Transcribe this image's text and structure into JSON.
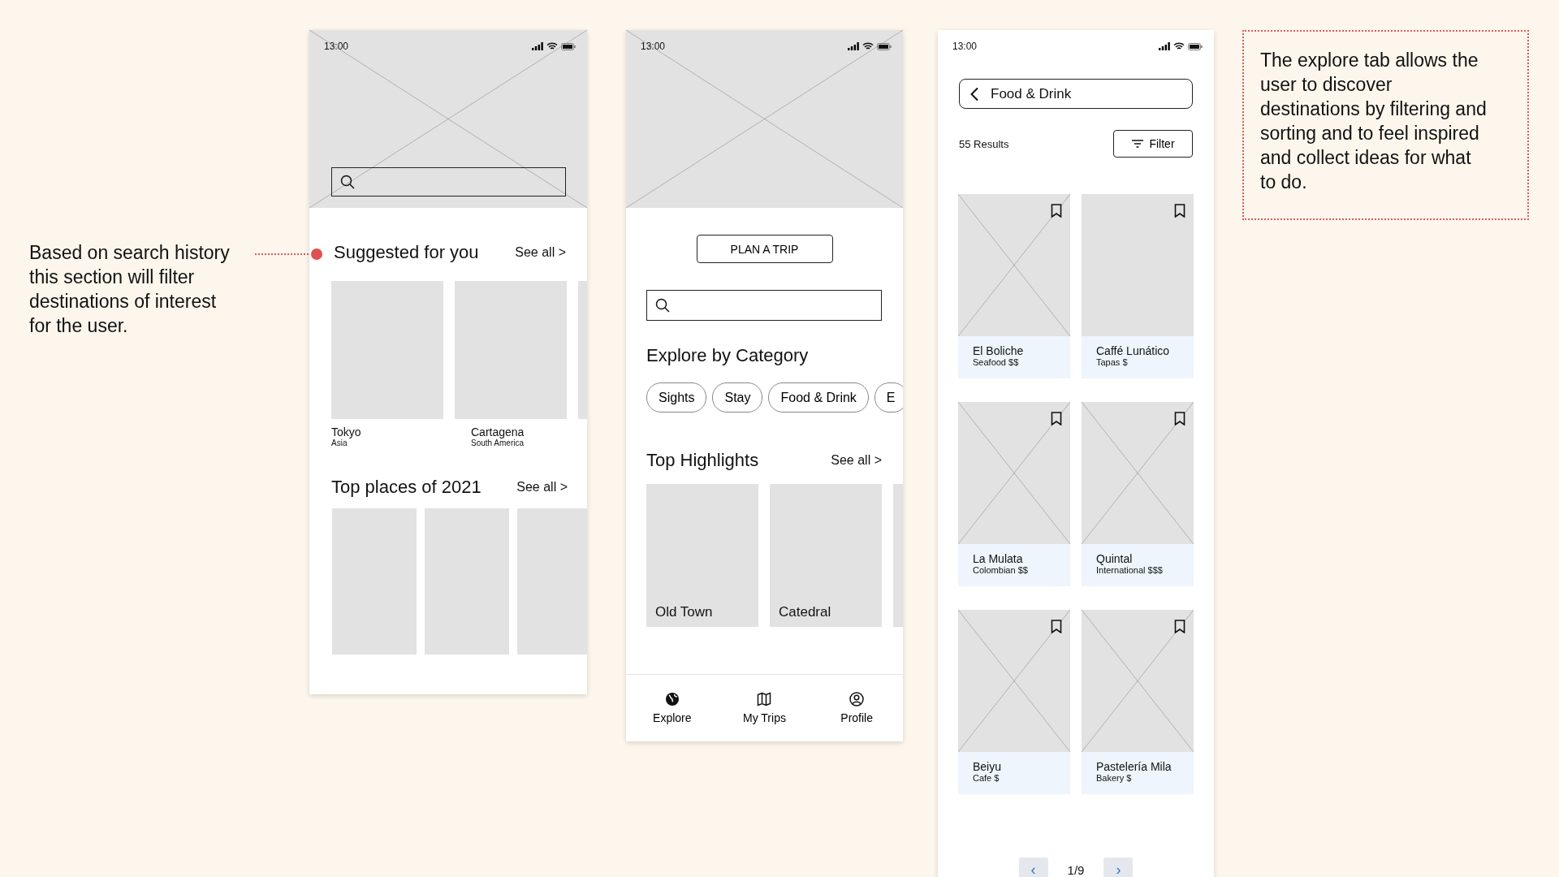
{
  "annotation_left": {
    "text": "Based on search history this section will filter destinations of interest for the user."
  },
  "note_right": {
    "text": "The explore tab allows the user to discover destinations by filtering and sorting and to feel inspired and collect ideas for what to do."
  },
  "screen_home": {
    "status_time": "13:00",
    "suggested": {
      "title": "Suggested for you",
      "see_all": "See all >",
      "cards": [
        {
          "name": "Tokyo",
          "region": "Asia"
        },
        {
          "name": "Cartagena",
          "region": "South America"
        }
      ]
    },
    "top_places": {
      "title": "Top places of 2021",
      "see_all": "See all >"
    }
  },
  "screen_explore": {
    "status_time": "13:00",
    "plan_button": "PLAN A TRIP",
    "category_title": "Explore by Category",
    "categories": [
      "Sights",
      "Stay",
      "Food & Drink",
      "E"
    ],
    "highlights_title": "Top Highlights",
    "see_all": "See all >",
    "highlights": [
      "Old Town",
      "Catedral"
    ],
    "nav": [
      {
        "kind": "globe",
        "label": "Explore"
      },
      {
        "kind": "map",
        "label": "My Trips"
      },
      {
        "kind": "profile",
        "label": "Profile"
      }
    ]
  },
  "screen_results": {
    "status_time": "13:00",
    "category": "Food & Drink",
    "results": "55 Results",
    "filter_button": "Filter",
    "places": [
      {
        "name": "El Boliche",
        "detail": "Seafood $$",
        "crossed": true
      },
      {
        "name": "Caffé Lunático",
        "detail": "Tapas $",
        "crossed": false
      },
      {
        "name": "La Mulata",
        "detail": "Colombian $$",
        "crossed": true
      },
      {
        "name": "Quintal",
        "detail": "International $$$",
        "crossed": true
      },
      {
        "name": "Beiyu",
        "detail": "Cafe $",
        "crossed": true
      },
      {
        "name": "Pastelería Mila",
        "detail": "Bakery $",
        "crossed": true
      }
    ],
    "pagination": {
      "prev": "‹",
      "page": "1/9",
      "next": "›"
    }
  }
}
